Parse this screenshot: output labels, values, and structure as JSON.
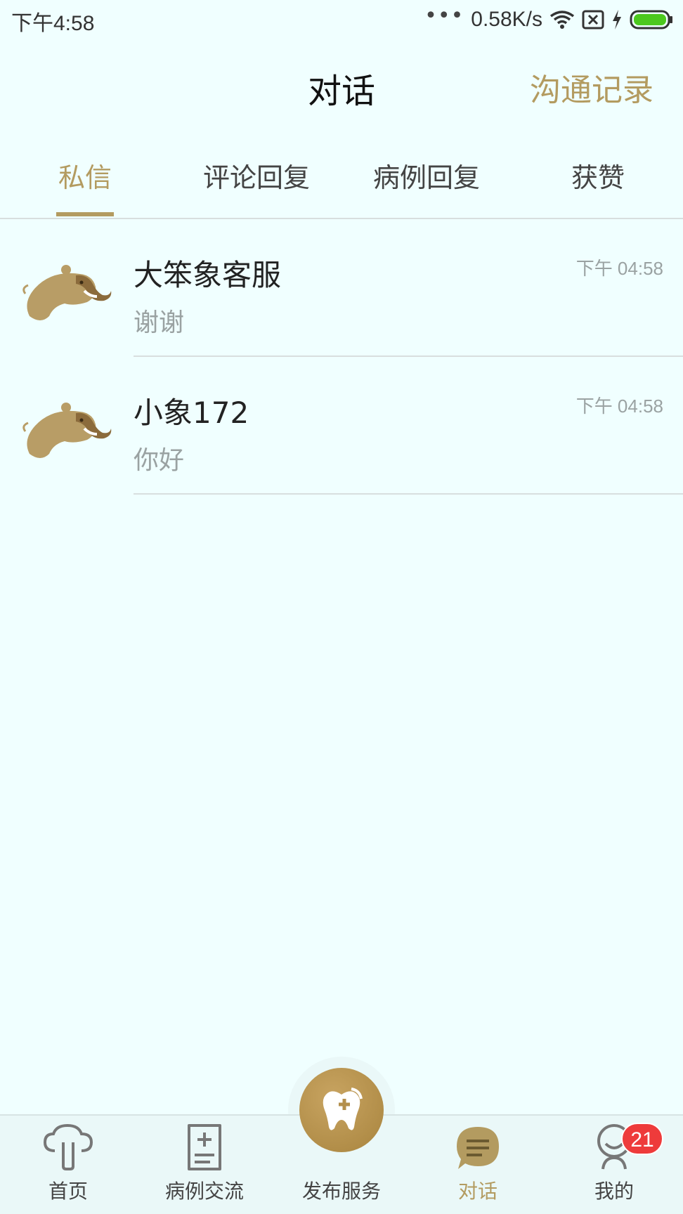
{
  "status_bar": {
    "time": "下午4:58",
    "dots": "•••",
    "network_speed": "0.58K/s",
    "battery_color": "#4cc81e"
  },
  "header": {
    "title": "对话",
    "action": "沟通记录"
  },
  "tabs": [
    {
      "label": "私信",
      "active": true
    },
    {
      "label": "评论回复",
      "active": false
    },
    {
      "label": "病例回复",
      "active": false
    },
    {
      "label": "获赞",
      "active": false
    }
  ],
  "conversations": [
    {
      "name": "大笨象客服",
      "time": "下午 04:58",
      "preview": "谢谢",
      "avatar": "elephant-avatar-icon"
    },
    {
      "name": "小象172",
      "time": "下午 04:58",
      "preview": "你好",
      "avatar": "elephant-avatar-icon"
    }
  ],
  "bottom_nav": [
    {
      "label": "首页",
      "icon": "home-tree-icon",
      "active": false
    },
    {
      "label": "病例交流",
      "icon": "case-document-icon",
      "active": false
    },
    {
      "label": "发布服务",
      "icon": "tooth-plus-icon",
      "active": false
    },
    {
      "label": "对话",
      "icon": "chat-bubble-icon",
      "active": true
    },
    {
      "label": "我的",
      "icon": "profile-icon",
      "active": false,
      "badge": "21"
    }
  ],
  "colors": {
    "background": "#f0ffff",
    "accent": "#b39b60",
    "badge": "#ee3b3b"
  }
}
